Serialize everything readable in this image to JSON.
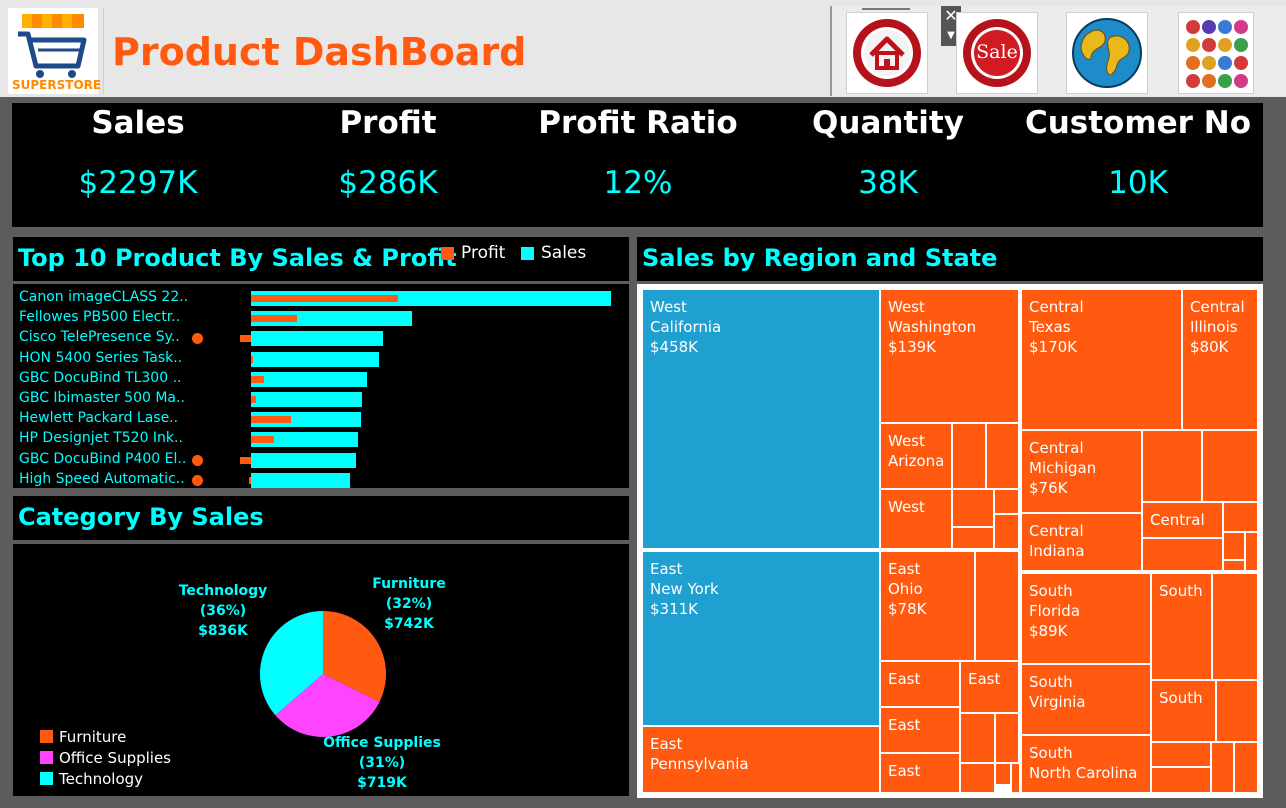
{
  "header": {
    "logo_text": "SUPERSTORE",
    "title": "Product DashBoard",
    "nav_icons": [
      "home-icon",
      "sale-icon",
      "globe-icon",
      "apps-grid-icon"
    ],
    "sale_text": "Sale"
  },
  "kpis": [
    {
      "label": "Sales",
      "value": "$2297K"
    },
    {
      "label": "Profit",
      "value": "$286K"
    },
    {
      "label": "Profit Ratio",
      "value": "12%"
    },
    {
      "label": "Quantity",
      "value": "38K"
    },
    {
      "label": "Customer No",
      "value": "10K"
    }
  ],
  "top10": {
    "title": "Top 10 Product By Sales & Profit",
    "legend": {
      "profit": "Profit",
      "sales": "Sales"
    },
    "colors": {
      "profit": "#ff5a10",
      "sales": "#00ffff"
    },
    "products": [
      {
        "name": "Canon imageCLASS 22..",
        "sales": 61.6,
        "profit": 25.2,
        "loss_marker": false
      },
      {
        "name": "Fellowes PB500 Electr..",
        "sales": 27.5,
        "profit": 7.8,
        "loss_marker": false
      },
      {
        "name": "Cisco TelePresence Sy..",
        "sales": 22.6,
        "profit": -1.8,
        "loss_marker": true
      },
      {
        "name": "HON 5400 Series Task..",
        "sales": 21.9,
        "profit": 0.1,
        "loss_marker": false
      },
      {
        "name": "GBC DocuBind TL300 ..",
        "sales": 19.8,
        "profit": 2.2,
        "loss_marker": false
      },
      {
        "name": "GBC Ibimaster 500 Ma..",
        "sales": 19.0,
        "profit": 0.8,
        "loss_marker": false
      },
      {
        "name": "Hewlett Packard Lase..",
        "sales": 18.8,
        "profit": 6.8,
        "loss_marker": false
      },
      {
        "name": "HP Designjet T520 Ink..",
        "sales": 18.4,
        "profit": 4.0,
        "loss_marker": false
      },
      {
        "name": "GBC DocuBind P400 El..",
        "sales": 18.0,
        "profit": -1.9,
        "loss_marker": true
      },
      {
        "name": "High Speed Automatic..",
        "sales": 17.0,
        "profit": -0.3,
        "loss_marker": true
      }
    ]
  },
  "category": {
    "title": "Category By Sales",
    "slices": [
      {
        "name": "Furniture",
        "pct": 32,
        "pct_label": "(32%)",
        "value": "$742K",
        "color": "#ff5a10"
      },
      {
        "name": "Office Supplies",
        "pct": 31,
        "pct_label": "(31%)",
        "value": "$719K",
        "color": "#ff44ff"
      },
      {
        "name": "Technology",
        "pct": 36,
        "pct_label": "(36%)",
        "value": "$836K",
        "color": "#00ffff"
      }
    ]
  },
  "treemap": {
    "title": "Sales by Region and State",
    "colors": {
      "west_east": "#1fa0d0",
      "other": "#ff5a10"
    },
    "cells": {
      "west_california": {
        "region": "West",
        "state": "California",
        "value": "$458K"
      },
      "west_washington": {
        "region": "West",
        "state": "Washington",
        "value": "$139K"
      },
      "west_arizona": {
        "region": "West",
        "state": "Arizona"
      },
      "west_small": {
        "region": "West"
      },
      "central_texas": {
        "region": "Central",
        "state": "Texas",
        "value": "$170K"
      },
      "central_illinois": {
        "region": "Central",
        "state": "Illinois",
        "value": "$80K"
      },
      "central_michigan": {
        "region": "Central",
        "state": "Michigan",
        "value": "$76K"
      },
      "central_indiana": {
        "region": "Central",
        "state": "Indiana"
      },
      "central_small": {
        "region": "Central"
      },
      "east_newyork": {
        "region": "East",
        "state": "New York",
        "value": "$311K"
      },
      "east_pennsylvania": {
        "region": "East",
        "state": "Pennsylvania"
      },
      "east_ohio": {
        "region": "East",
        "state": "Ohio",
        "value": "$78K"
      },
      "east_small1": {
        "region": "East"
      },
      "east_small2": {
        "region": "East"
      },
      "east_small3": {
        "region": "East"
      },
      "east_small4": {
        "region": "East"
      },
      "south_florida": {
        "region": "South",
        "state": "Florida",
        "value": "$89K"
      },
      "south_virginia": {
        "region": "South",
        "state": "Virginia"
      },
      "south_ncarolina": {
        "region": "South",
        "state": "North Carolina"
      },
      "south_small1": {
        "region": "South"
      },
      "south_small2": {
        "region": "South"
      }
    }
  }
}
